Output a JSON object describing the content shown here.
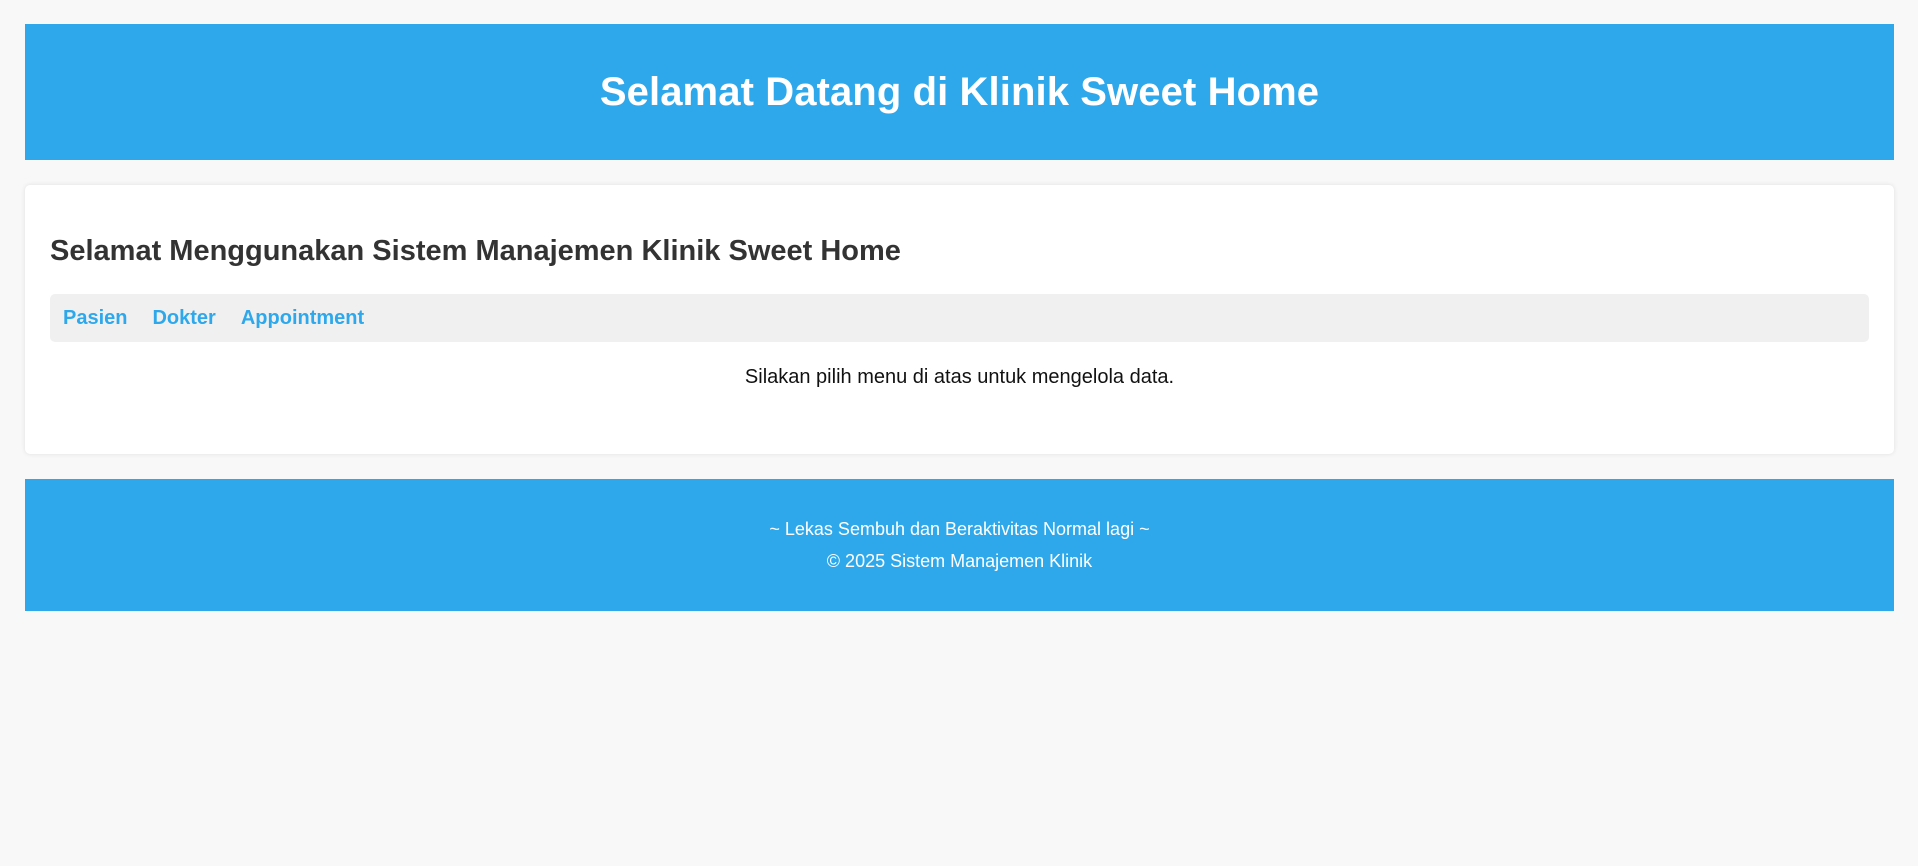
{
  "header": {
    "title": "Selamat Datang di Klinik Sweet Home"
  },
  "main": {
    "heading": "Selamat Menggunakan Sistem Manajemen Klinik Sweet Home",
    "nav": [
      {
        "label": "Pasien"
      },
      {
        "label": "Dokter"
      },
      {
        "label": "Appointment"
      }
    ],
    "message": "Silakan pilih menu di atas untuk mengelola data."
  },
  "footer": {
    "tagline": "~ Lekas Sembuh dan Beraktivitas Normal lagi ~",
    "copyright": "© 2025 Sistem Manajemen Klinik"
  },
  "colors": {
    "primary": "#2fa8eb",
    "background": "#f8f8f8",
    "nav_background": "#f0f0f0",
    "heading_text": "#333333"
  }
}
